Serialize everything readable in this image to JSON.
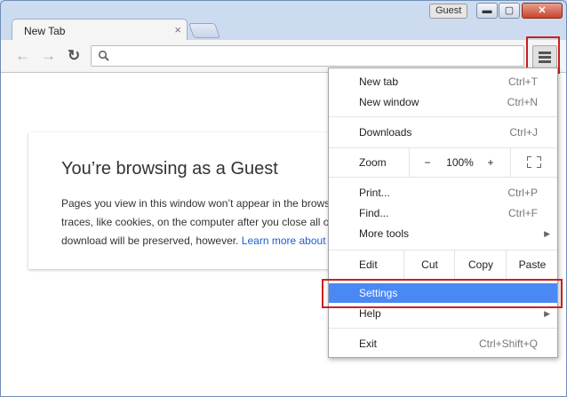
{
  "window": {
    "guest_label": "Guest",
    "minimize_icon": "minimize-icon",
    "maximize_icon": "maximize-icon",
    "close_icon": "close-icon"
  },
  "tab": {
    "title": "New Tab",
    "close": "×"
  },
  "toolbar": {
    "back": "←",
    "forward": "→",
    "reload": "↻",
    "search_icon": "🔍",
    "omnibox_value": ""
  },
  "guest_card": {
    "title": "You’re browsing as a Guest",
    "body_line1": "Pages you view in this window won’t appear in the brows",
    "body_line2": "traces, like cookies, on the computer after you close all o",
    "body_line3": "download will be preserved, however.",
    "learn_more": "Learn more about"
  },
  "menu": {
    "new_tab": {
      "label": "New tab",
      "shortcut": "Ctrl+T"
    },
    "new_window": {
      "label": "New window",
      "shortcut": "Ctrl+N"
    },
    "downloads": {
      "label": "Downloads",
      "shortcut": "Ctrl+J"
    },
    "zoom": {
      "label": "Zoom",
      "minus": "−",
      "value": "100%",
      "plus": "+"
    },
    "print": {
      "label": "Print...",
      "shortcut": "Ctrl+P"
    },
    "find": {
      "label": "Find...",
      "shortcut": "Ctrl+F"
    },
    "more_tools": {
      "label": "More tools"
    },
    "edit": {
      "label": "Edit",
      "cut": "Cut",
      "copy": "Copy",
      "paste": "Paste"
    },
    "settings": {
      "label": "Settings"
    },
    "help": {
      "label": "Help"
    },
    "exit": {
      "label": "Exit",
      "shortcut": "Ctrl+Shift+Q"
    },
    "submenu_arrow": "▶"
  },
  "colors": {
    "highlight": "#4a89f3",
    "annotation": "#cc1f1f",
    "link": "#1a5fd0"
  }
}
